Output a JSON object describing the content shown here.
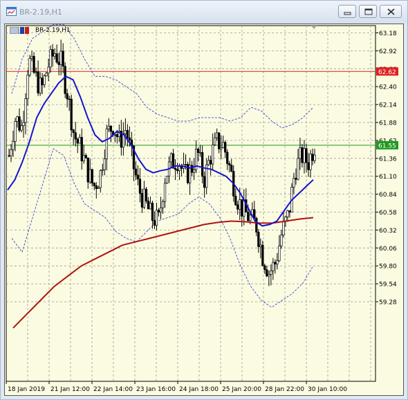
{
  "window": {
    "title": "BR-2.19,H1"
  },
  "chart_header": {
    "symbol_label": "BR-2.19,H1"
  },
  "colors": {
    "background": "#fafbe0",
    "grid": "#9a9a9a",
    "candle": "#000000",
    "ma_fast": "#1414d0",
    "ma_slow": "#b01212",
    "bands": "#2a2ad8",
    "resistance_line": "#e02020",
    "bid_line": "#1f9a1f"
  },
  "chart_data": {
    "type": "candlestick",
    "timeframe": "H1",
    "y_ticks": [
      "63.18",
      "62.92",
      "62.66",
      "62.40",
      "62.14",
      "61.88",
      "61.62",
      "61.36",
      "61.10",
      "60.84",
      "60.58",
      "60.32",
      "60.06",
      "59.80",
      "59.54",
      "59.28"
    ],
    "x_ticks": [
      "18 Jan 2019",
      "21 Jan 12:00",
      "22 Jan 14:00",
      "23 Jan 16:00",
      "24 Jan 18:00",
      "25 Jan 20:00",
      "28 Jan 22:00",
      "30 Jan 10:00"
    ],
    "ylim": [
      59.0,
      63.3
    ],
    "horizontal_lines": [
      {
        "name": "resistance",
        "value": 62.62,
        "label": "62.62",
        "color": "#e02020"
      },
      {
        "name": "bid",
        "value": 61.55,
        "label": "61.55",
        "color": "#1f9a1f"
      }
    ],
    "close_path": [
      61.4,
      61.95,
      61.8,
      62.8,
      62.55,
      62.35,
      62.7,
      62.9,
      62.75,
      62.3,
      61.7,
      61.5,
      61.2,
      60.95,
      61.1,
      61.7,
      61.85,
      61.6,
      61.8,
      61.3,
      60.9,
      60.7,
      60.5,
      60.45,
      61.1,
      61.3,
      61.35,
      61.1,
      61.2,
      61.45,
      61.05,
      61.4,
      61.6,
      61.55,
      61.2,
      60.8,
      60.6,
      60.5,
      60.4,
      59.95,
      59.7,
      59.85,
      60.3,
      60.55,
      61.2,
      61.4,
      61.3,
      61.55
    ],
    "ma_fast": [
      60.9,
      61.05,
      61.3,
      61.6,
      61.95,
      62.15,
      62.3,
      62.45,
      62.55,
      62.5,
      62.25,
      61.95,
      61.7,
      61.6,
      61.65,
      61.75,
      61.7,
      61.55,
      61.35,
      61.2,
      61.15,
      61.18,
      61.2,
      61.25,
      61.25,
      61.22,
      61.25,
      61.22,
      61.2,
      61.15,
      61.1,
      61.0,
      60.85,
      60.65,
      60.45,
      60.38,
      60.4,
      60.45,
      60.6,
      60.75,
      60.85,
      60.95,
      61.05
    ],
    "ma_slow": [
      58.9,
      59.1,
      59.3,
      59.5,
      59.65,
      59.8,
      59.9,
      60.0,
      60.1,
      60.15,
      60.2,
      60.25,
      60.3,
      60.35,
      60.4,
      60.43,
      60.45,
      60.44,
      60.42,
      60.42,
      60.45,
      60.48,
      60.5
    ],
    "band_upper": [
      62.3,
      62.8,
      63.1,
      63.2,
      63.3,
      63.3,
      63.1,
      62.8,
      62.55,
      62.55,
      62.5,
      62.4,
      62.3,
      62.1,
      62.0,
      61.95,
      61.9,
      61.9,
      61.95,
      61.95,
      61.95,
      61.9,
      61.95,
      62.1,
      62.05,
      61.9,
      61.8,
      61.85,
      61.95,
      62.1
    ],
    "band_lower": [
      60.2,
      60.0,
      60.5,
      61.0,
      61.5,
      61.4,
      61.0,
      60.7,
      60.6,
      60.5,
      60.3,
      60.2,
      60.15,
      60.3,
      60.45,
      60.5,
      60.55,
      60.7,
      60.8,
      60.7,
      60.5,
      60.2,
      59.8,
      59.5,
      59.3,
      59.2,
      59.3,
      59.4,
      59.55,
      59.8
    ]
  }
}
